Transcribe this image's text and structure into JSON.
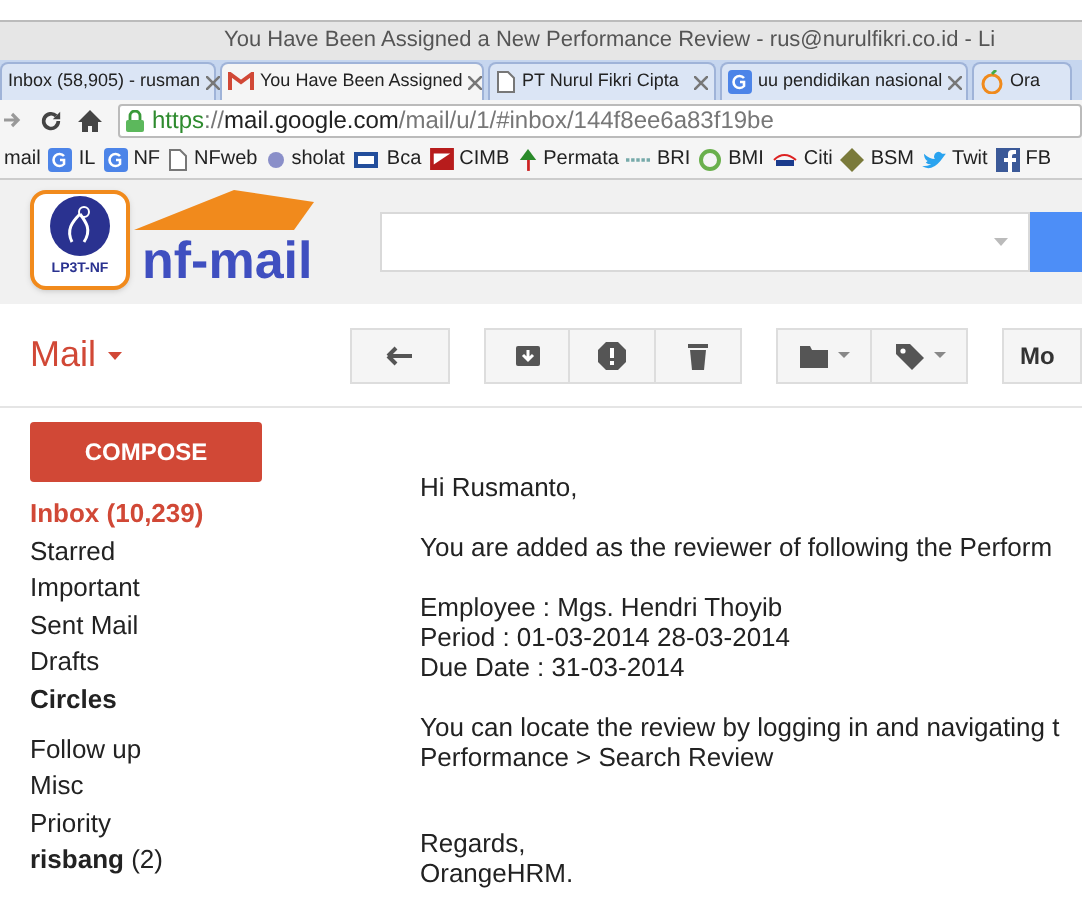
{
  "window": {
    "title": "You Have Been Assigned a New Performance Review - rus@nurulfikri.co.id - Li"
  },
  "tabs": [
    {
      "label": "Inbox (58,905) - rusman",
      "selected": false
    },
    {
      "label": "You Have Been Assigned",
      "selected": true
    },
    {
      "label": "PT Nurul Fikri Cipta",
      "selected": false
    },
    {
      "label": "uu pendidikan nasional",
      "selected": false
    },
    {
      "label": "Ora",
      "selected": false
    }
  ],
  "address": {
    "scheme": "https",
    "separator": "://",
    "host": "mail.google.com",
    "path": "/mail/u/1/#inbox/144f8ee6a83f19be"
  },
  "bookmarks": [
    "mail",
    "IL",
    "NF",
    "NFweb",
    "sholat",
    "Bca",
    "CIMB",
    "Permata",
    "BRI",
    "BMI",
    "Citi",
    "BSM",
    "Twit",
    "FB"
  ],
  "logo": {
    "badge": "LP3T-NF",
    "name": "nf-mail"
  },
  "app_menu": {
    "label": "Mail"
  },
  "toolbar": {
    "more": "Mo"
  },
  "compose": {
    "label": "COMPOSE"
  },
  "folders": [
    {
      "label": "Inbox (10,239)",
      "selected": true,
      "bold": true
    },
    {
      "label": "Starred",
      "selected": false,
      "bold": false
    },
    {
      "label": "Important",
      "selected": false,
      "bold": false
    },
    {
      "label": "Sent Mail",
      "selected": false,
      "bold": false
    },
    {
      "label": "Drafts",
      "selected": false,
      "bold": false
    },
    {
      "label": "Circles",
      "selected": false,
      "bold": true
    },
    {
      "label": "Follow up",
      "selected": false,
      "bold": false
    },
    {
      "label": "Misc",
      "selected": false,
      "bold": false
    },
    {
      "label": "Priority",
      "selected": false,
      "bold": false
    },
    {
      "label": "**risbang** (2)",
      "selected": false,
      "bold": false
    }
  ],
  "message": {
    "paragraphs": [
      [
        "Hi Rusmanto,"
      ],
      [
        "You are added as the reviewer of following the Perform"
      ],
      [
        "Employee : Mgs. Hendri Thoyib",
        "Period : 01-03-2014 28-03-2014",
        "Due Date : 31-03-2014"
      ],
      [
        "You can locate the review by logging in and navigating t",
        "Performance > Search Review"
      ],
      [
        "Regards,",
        "OrangeHRM."
      ]
    ]
  }
}
